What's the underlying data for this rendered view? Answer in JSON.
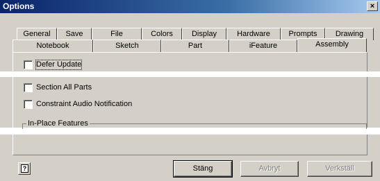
{
  "window": {
    "title": "Options",
    "close_glyph": "×"
  },
  "tabs_row1": [
    "General",
    "Save",
    "File",
    "Colors",
    "Display",
    "Hardware",
    "Prompts",
    "Drawing"
  ],
  "tabs_row2": [
    "Notebook",
    "Sketch",
    "Part",
    "iFeature",
    "Assembly"
  ],
  "active_tab": "Assembly",
  "options": {
    "defer_update": {
      "label": "Defer Update",
      "checked": false
    },
    "section_all_parts": {
      "label": "Section All Parts",
      "checked": false
    },
    "constraint_audio": {
      "label": "Constraint Audio Notification",
      "checked": false
    }
  },
  "groups": {
    "in_place_features": "In-Place Features"
  },
  "buttons": {
    "close": "Stäng",
    "cancel": "Avbryt",
    "apply": "Verkställ"
  },
  "icons": {
    "help": "help-icon"
  }
}
